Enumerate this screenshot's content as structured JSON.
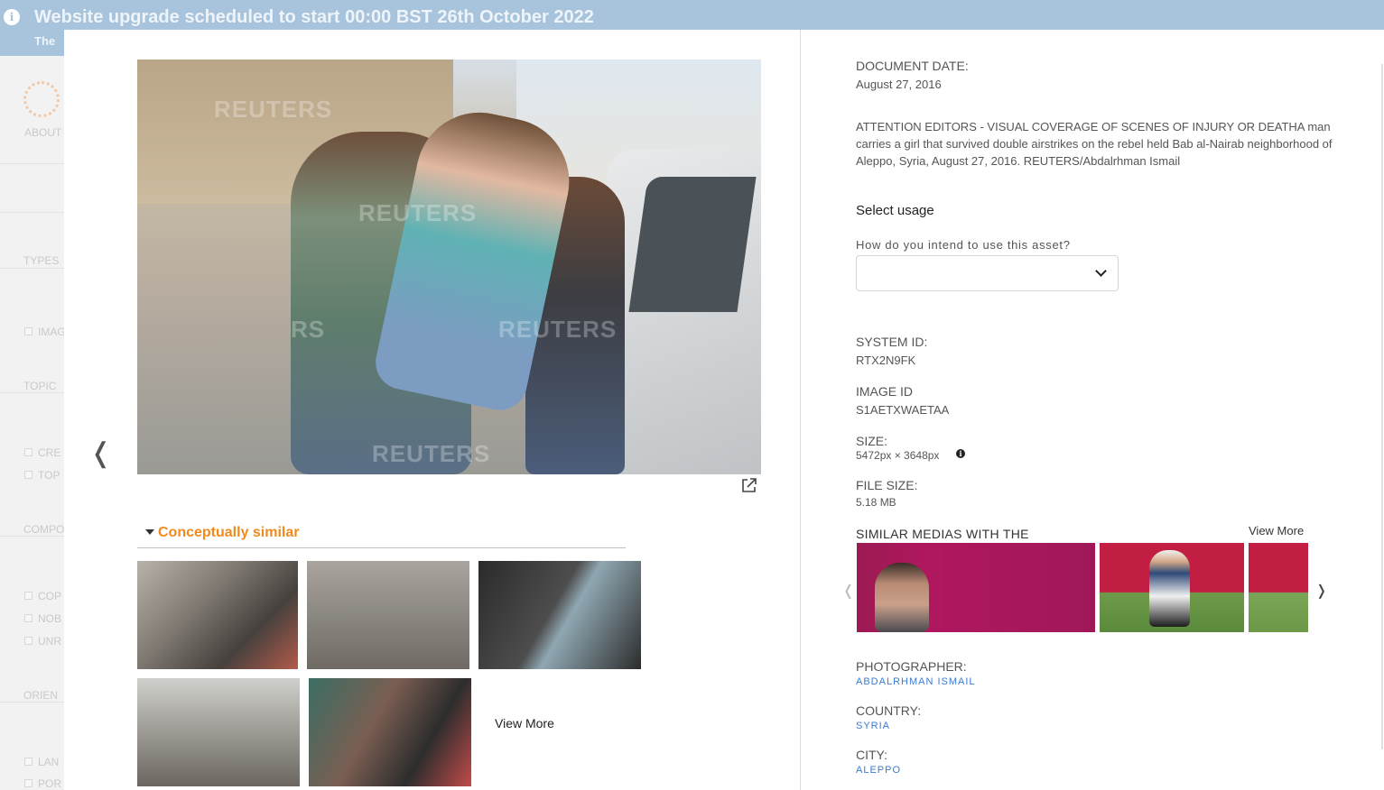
{
  "banner": {
    "title": "Website upgrade scheduled to start 00:00 BST 26th October 2022",
    "subtitle": "The"
  },
  "background_sidebar": {
    "about": "ABOUT",
    "types": "TYPES",
    "images": "IMAG",
    "topic": "TOPIC",
    "creative": "CRE",
    "top": "TOP",
    "composition": "COMPO",
    "copy": "COP",
    "nob": "NOB",
    "unr": "UNR",
    "orientation": "ORIEN",
    "landscape": "LAN",
    "portrait": "POR"
  },
  "photo": {
    "watermark": "REUTERS",
    "watermark_partial": "RS"
  },
  "conceptually_similar": {
    "title": "Conceptually similar",
    "view_more": "View More"
  },
  "details": {
    "document_date_label": "DOCUMENT DATE:",
    "document_date": "August 27, 2016",
    "caption": "ATTENTION EDITORS - VISUAL COVERAGE OF SCENES OF INJURY OR DEATHA man carries a girl that survived double airstrikes on the rebel held Bab al-Nairab neighborhood of Aleppo, Syria, August 27, 2016. REUTERS/Abdalrhman Ismail",
    "select_usage": "Select usage",
    "intend_label": "How do you intend to use this asset?",
    "usage_value": "",
    "system_id_label": "SYSTEM ID:",
    "system_id": "RTX2N9FK",
    "image_id_label": "IMAGE ID",
    "image_id": "S1AETXWAETAA",
    "size_label": "SIZE:",
    "size": "5472px × 3648px",
    "file_size_label": "FILE SIZE:",
    "file_size": "5.18 MB",
    "similar_title": "SIMILAR MEDIAS WITH THE",
    "similar_view_more": "View More",
    "photographer_label": "PHOTOGRAPHER:",
    "photographer": "ABDALRHMAN ISMAIL",
    "country_label": "COUNTRY:",
    "country": "SYRIA",
    "city_label": "CITY:",
    "city": "ALEPPO"
  },
  "icons": {
    "info": "i",
    "prev_arrow": "❬",
    "carousel_prev": "❬",
    "carousel_next": "❭"
  }
}
